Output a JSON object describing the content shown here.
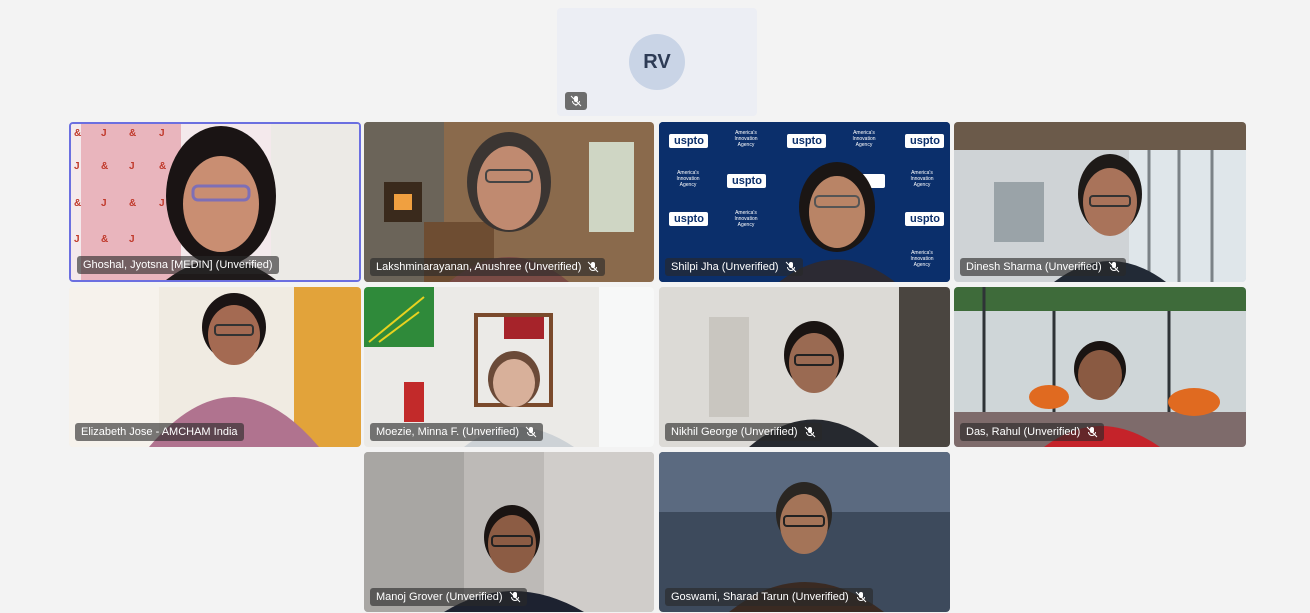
{
  "top_tile": {
    "initials": "RV"
  },
  "participants": [
    {
      "name": "Ghoshal, Jyotsna [MEDIN] (Unverified)",
      "speaking": true
    },
    {
      "name": "Lakshminarayanan, Anushree (Unverified)"
    },
    {
      "name": "Shilpi Jha (Unverified)"
    },
    {
      "name": "Dinesh Sharma (Unverified)"
    },
    {
      "name": "Elizabeth Jose - AMCHAM India"
    },
    {
      "name": "Moezie, Minna F. (Unverified)"
    },
    {
      "name": "Nikhil George (Unverified)"
    },
    {
      "name": "Das, Rahul (Unverified)"
    },
    {
      "name": "Manoj Grover (Unverified)"
    },
    {
      "name": "Goswami, Sharad Tarun (Unverified)"
    }
  ],
  "uspto_background": {
    "logo": "uspto",
    "tagline": "America's Innovation Agency"
  },
  "colors": {
    "speaking_border": "#6b6fe0",
    "uspto_blue": "#0b2f6b"
  }
}
